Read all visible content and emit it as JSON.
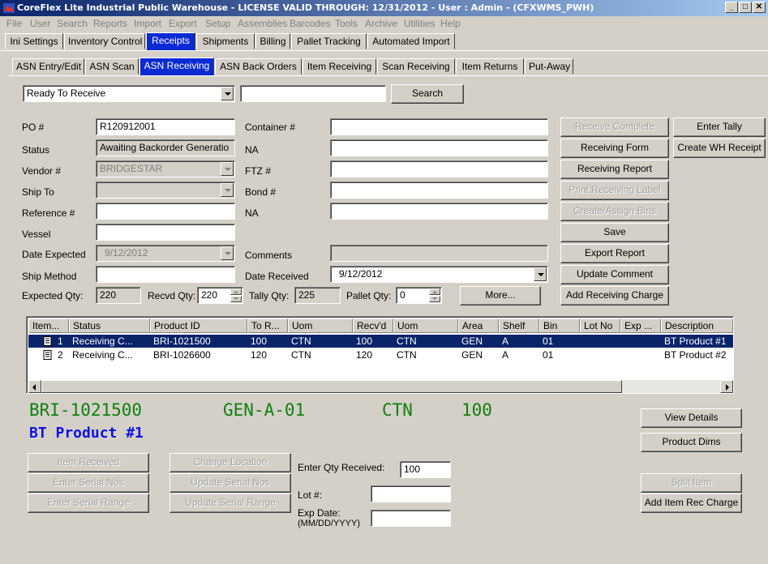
{
  "window": {
    "title": "CoreFlex Lite Industrial Public Warehouse - LICENSE VALID THROUGH: 12/31/2012 - User : Admin - (CFXWMS_PWH)",
    "minimize": "_",
    "maximize": "□",
    "close": "✕"
  },
  "menu": [
    "File",
    "User",
    "Search",
    "Reports",
    "Import",
    "Export",
    "Setup",
    "Assemblies",
    "Barcodes",
    "Tools",
    "Archive",
    "Utilities",
    "Help"
  ],
  "main_tabs": [
    "Ini Settings",
    "Inventory Control",
    "Receipts",
    "Shipments",
    "Billing",
    "Pallet Tracking",
    "Automated Import"
  ],
  "sub_tabs": [
    "ASN Entry/Edit",
    "ASN Scan",
    "ASN Receiving",
    "ASN Back Orders",
    "Item Receiving",
    "Scan Receiving",
    "Item Returns",
    "Put-Away"
  ],
  "filter": {
    "status_value": "Ready To Receive",
    "search_value": "",
    "search_button": "Search"
  },
  "form": {
    "po_label": "PO #",
    "po_value": "R120912001",
    "status_label": "Status",
    "status_value": "Awaiting Backorder Generatio",
    "vendor_label": "Vendor #",
    "vendor_value": "BRIDGESTAR",
    "shipto_label": "Ship To",
    "shipto_value": "",
    "reference_label": "Reference #",
    "reference_value": "",
    "vessel_label": "Vessel",
    "vessel_value": "",
    "date_expected_label": "Date Expected",
    "date_expected_value": "9/12/2012",
    "ship_method_label": "Ship Method",
    "ship_method_value": "",
    "container_label": "Container #",
    "container_value": "",
    "na1_label": "NA",
    "na1_value": "",
    "ftz_label": "FTZ #",
    "ftz_value": "",
    "bond_label": "Bond #",
    "bond_value": "",
    "na2_label": "NA",
    "na2_value": "",
    "comments_label": "Comments",
    "comments_value": "",
    "date_received_label": "Date Received",
    "date_received_value": "9/12/2012",
    "expected_qty_label": "Expected Qty:",
    "expected_qty_value": "220",
    "recvd_qty_label": "Recvd Qty:",
    "recvd_qty_value": "220",
    "tally_qty_label": "Tally Qty:",
    "tally_qty_value": "225",
    "pallet_qty_label": "Pallet Qty:",
    "pallet_qty_value": "0",
    "more_button": "More..."
  },
  "actions": {
    "receive_complete": "Receive Complete",
    "receiving_form": "Receiving Form",
    "receiving_report": "Receiving Report",
    "print_receiving_label": "Print Receiving Label",
    "create_assign_bins": "Create/Assign Bins",
    "save": "Save",
    "export_report": "Export Report",
    "update_comment": "Update Comment",
    "add_receiving_charge": "Add Receiving Charge",
    "enter_tally": "Enter Tally",
    "create_wh_receipt": "Create WH Receipt"
  },
  "grid": {
    "columns": [
      "Item...",
      "Status",
      "Product ID",
      "To R...",
      "Uom",
      "Recv'd",
      "Uom",
      "Area",
      "Shelf",
      "Bin",
      "Lot No",
      "Exp ...",
      "Description"
    ],
    "rows": [
      [
        "1",
        "Receiving C...",
        "BRI-1021500",
        "100",
        "CTN",
        "100",
        "CTN",
        "GEN",
        "A",
        "01",
        "",
        "",
        "BT Product #1"
      ],
      [
        "2",
        "Receiving C...",
        "BRI-1026600",
        "120",
        "CTN",
        "120",
        "CTN",
        "GEN",
        "A",
        "01",
        "",
        "",
        "BT Product #2"
      ]
    ]
  },
  "selected": {
    "product_id": "BRI-1021500",
    "location": "GEN-A-01",
    "uom": "CTN",
    "qty": "100",
    "description": "BT Product #1"
  },
  "bottom": {
    "item_received": "Item Received",
    "enter_serial_nos": "Enter Serial Nos",
    "enter_serial_range": "Enter Serial Range",
    "change_location": "Change Location",
    "update_serial_nos": "Update Serial Nos",
    "update_serial_range": "Update Serial Range",
    "enter_qty_label": "Enter Qty Received:",
    "enter_qty_value": "100",
    "lot_label": "Lot #:",
    "lot_value": "",
    "exp_date_label": "Exp Date:",
    "exp_date_format": "(MM/DD/YYYY)",
    "exp_date_value": "",
    "view_details": "View Details",
    "product_dims": "Product Dims",
    "split_item": "Split Item",
    "add_item_rec_charge": "Add Item Rec Charge"
  },
  "colors": {
    "title_start": "#0a246a",
    "active_tab": "#0a2ad4",
    "green_text": "#108010",
    "blue_text": "#1010e0"
  }
}
